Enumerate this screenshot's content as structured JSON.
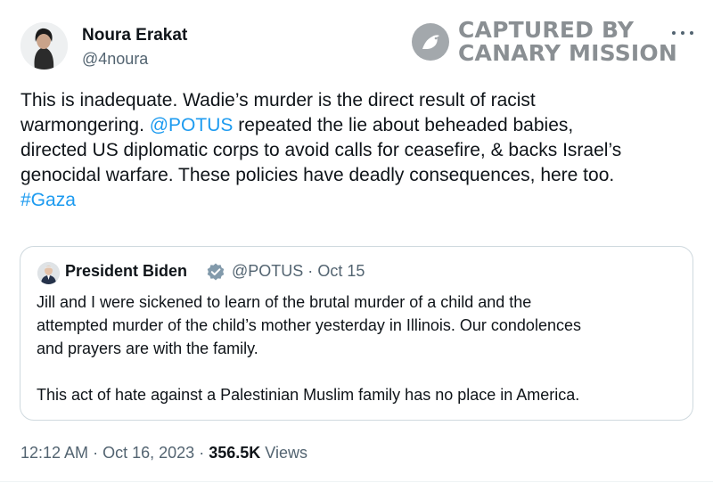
{
  "author": {
    "name": "Noura Erakat",
    "handle": "@4noura"
  },
  "watermark": {
    "line1": "CAPTURED BY",
    "line2": "CANARY MISSION",
    "icon": "canary-bird-icon"
  },
  "menu": {
    "icon": "more-options-icon"
  },
  "tweet": {
    "lines": [
      [
        {
          "t": "This is inadequate. Wadie’s murder is the direct result of racist"
        }
      ],
      [
        {
          "t": "warmongering. "
        },
        {
          "t": "@POTUS",
          "link": true
        },
        {
          "t": " repeated the lie about beheaded babies,"
        }
      ],
      [
        {
          "t": "directed US diplomatic corps to avoid calls for ceasefire, & backs Israel’s"
        }
      ],
      [
        {
          "t": "genocidal warfare. These policies have deadly consequences, here too."
        }
      ],
      [
        {
          "t": "#Gaza",
          "link": true
        }
      ]
    ]
  },
  "quote": {
    "name": "President Biden",
    "handle": "@POTUS",
    "separator": "·",
    "date": "Oct 15",
    "verified_icon": "verified-badge-icon",
    "lines": [
      "Jill and I were sickened to learn of the brutal murder of a child and the",
      "attempted murder of the child’s mother yesterday in Illinois. Our condolences",
      "and prayers are with the family.",
      "",
      "This act of hate against a Palestinian Muslim family has no place in America."
    ]
  },
  "meta": {
    "time": "12:12 AM",
    "sep1": "·",
    "date": "Oct 16, 2023",
    "sep2": "·",
    "views_count": "356.5K",
    "views_label": "Views"
  },
  "colors": {
    "link": "#1d9bf0",
    "secondary": "#536471",
    "text": "#0f1419",
    "border": "#cfd9de",
    "watermark": "#8a8f93"
  }
}
